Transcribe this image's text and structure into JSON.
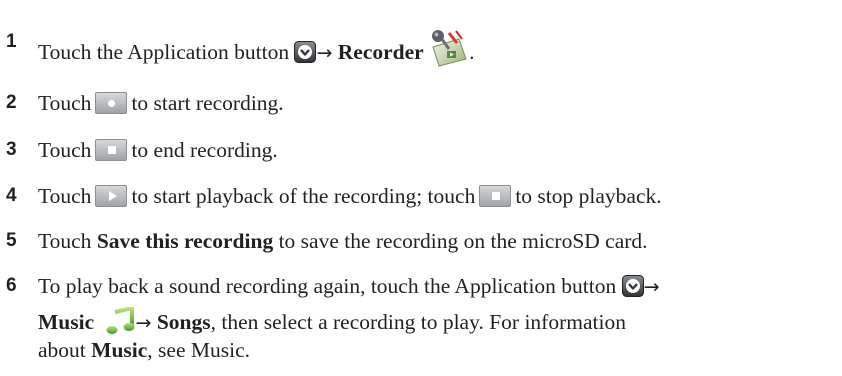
{
  "steps": [
    {
      "num": "1",
      "a": "Touch the Application button",
      "arrow": "→",
      "b": "Recorder",
      "c": "."
    },
    {
      "num": "2",
      "a": "Touch",
      "b": "to start recording."
    },
    {
      "num": "3",
      "a": "Touch",
      "b": "to end recording."
    },
    {
      "num": "4",
      "a": "Touch",
      "b": "to start playback of the recording; touch",
      "c": "to stop playback."
    },
    {
      "num": "5",
      "a": "Touch",
      "b": "Save this recording",
      "c": "to save the recording on the microSD card."
    },
    {
      "num": "6",
      "line1": "To play back a sound recording again, touch the Application button",
      "arrow1": "→",
      "music": "Music",
      "arrow2": "→",
      "songs": "Songs",
      "line2_rest": ", then select a recording to play. For information",
      "line3_a": "about",
      "line3_music": "Music",
      "line3_rest": ", see Music."
    }
  ],
  "icons": {
    "app_button": "application-button-icon",
    "recorder": "recorder-app-icon",
    "record": "record-button-icon",
    "stop": "stop-button-icon",
    "play": "play-button-icon",
    "music": "music-app-icon"
  },
  "colors": {
    "text": "#231f20",
    "button_gray": "#b5b8bb",
    "app_button": "#4a4f55",
    "music_green": "#6fc04b"
  }
}
